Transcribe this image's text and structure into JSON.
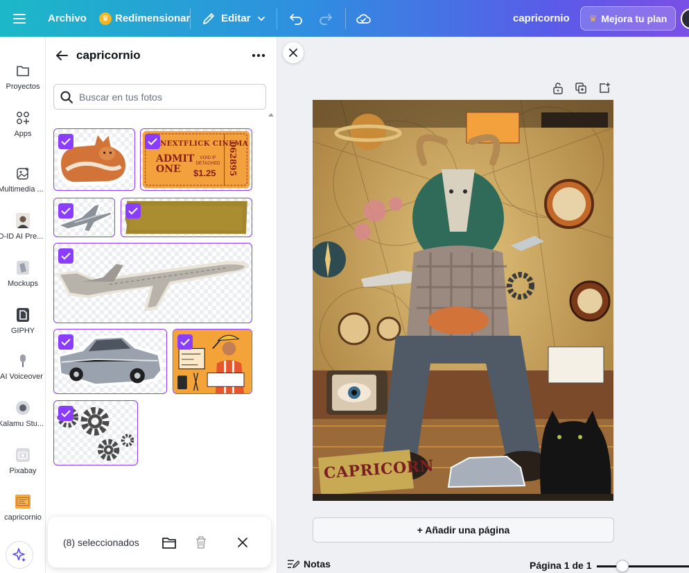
{
  "topbar": {
    "file_label": "Archivo",
    "resize_label": "Redimensionar",
    "edit_label": "Editar",
    "doc_title": "capricornio",
    "upgrade_label": "Mejora tu plan"
  },
  "rail": {
    "items": [
      {
        "label": "Proyectos"
      },
      {
        "label": "Apps"
      },
      {
        "label": "Multimedia ..."
      },
      {
        "label": "D-ID AI Pre..."
      },
      {
        "label": "Mockups"
      },
      {
        "label": "GIPHY"
      },
      {
        "label": "AI Voiceover"
      },
      {
        "label": "Kalamu Stu..."
      },
      {
        "label": "Pixabay"
      },
      {
        "label": "capricornio"
      }
    ]
  },
  "panel": {
    "title": "capricornio",
    "search_placeholder": "Buscar en tus fotos",
    "selection_count": "(8) seleccionados",
    "photos": [
      {
        "name": "cat",
        "selected": true
      },
      {
        "name": "cinema-ticket",
        "selected": true
      },
      {
        "name": "small-plane",
        "selected": true
      },
      {
        "name": "old-paper",
        "selected": true
      },
      {
        "name": "airplane",
        "selected": true
      },
      {
        "name": "vintage-car",
        "selected": true
      },
      {
        "name": "engineer-illustration",
        "selected": true
      },
      {
        "name": "gears",
        "selected": true
      }
    ],
    "ticket": {
      "top": "NEXTFLICK CINEMA",
      "admit": "ADMIT ONE",
      "void": "VOID IF DETACHED",
      "price": "$1.25",
      "number": "062895"
    }
  },
  "canvas": {
    "design_caption": "CAPRICORN",
    "add_page_label": "+ Añadir una página",
    "notes_label": "Notas",
    "page_indicator": "Página 1 de 1",
    "zoom_fraction": 0.2
  },
  "colors": {
    "accent": "#8b3dff",
    "topbar_start": "#1cb8c8",
    "topbar_end": "#7a4fe6"
  }
}
